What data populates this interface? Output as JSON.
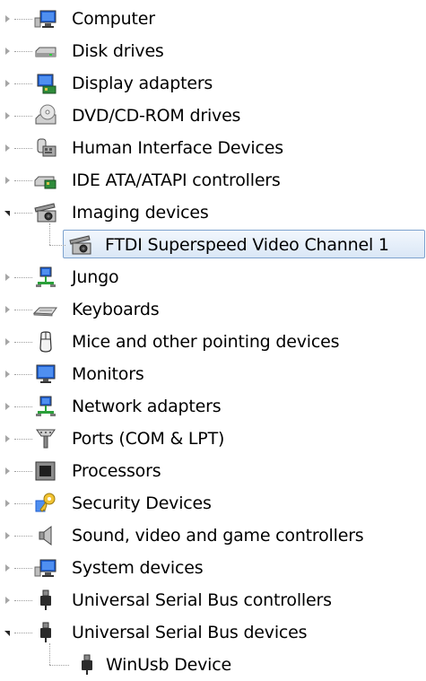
{
  "tree": {
    "items": [
      {
        "label": "Computer",
        "icon": "computer-icon",
        "state": "collapsed"
      },
      {
        "label": "Disk drives",
        "icon": "disk-drive-icon",
        "state": "collapsed"
      },
      {
        "label": "Display adapters",
        "icon": "display-adapter-icon",
        "state": "collapsed"
      },
      {
        "label": "DVD/CD-ROM drives",
        "icon": "dvd-drive-icon",
        "state": "collapsed"
      },
      {
        "label": "Human Interface Devices",
        "icon": "hid-icon",
        "state": "collapsed"
      },
      {
        "label": "IDE ATA/ATAPI controllers",
        "icon": "ide-controller-icon",
        "state": "collapsed"
      },
      {
        "label": "Imaging devices",
        "icon": "camera-icon",
        "state": "expanded"
      },
      {
        "label": "FTDI Superspeed Video Channel 1",
        "icon": "camera-icon",
        "state": "child-selected"
      },
      {
        "label": "Jungo",
        "icon": "network-icon",
        "state": "collapsed"
      },
      {
        "label": "Keyboards",
        "icon": "keyboard-icon",
        "state": "collapsed"
      },
      {
        "label": "Mice and other pointing devices",
        "icon": "mouse-icon",
        "state": "collapsed"
      },
      {
        "label": "Monitors",
        "icon": "monitor-icon",
        "state": "collapsed"
      },
      {
        "label": "Network adapters",
        "icon": "network-icon",
        "state": "collapsed"
      },
      {
        "label": "Ports (COM & LPT)",
        "icon": "port-icon",
        "state": "collapsed"
      },
      {
        "label": "Processors",
        "icon": "processor-icon",
        "state": "collapsed"
      },
      {
        "label": "Security Devices",
        "icon": "key-icon",
        "state": "collapsed"
      },
      {
        "label": "Sound, video and game controllers",
        "icon": "speaker-icon",
        "state": "collapsed"
      },
      {
        "label": "System devices",
        "icon": "computer-icon",
        "state": "collapsed"
      },
      {
        "label": "Universal Serial Bus controllers",
        "icon": "usb-plug-icon",
        "state": "collapsed"
      },
      {
        "label": "Universal Serial Bus devices",
        "icon": "usb-plug-icon",
        "state": "expanded"
      },
      {
        "label": "WinUsb Device",
        "icon": "usb-plug-icon",
        "state": "child"
      }
    ]
  },
  "colors": {
    "selection_border": "#7da2ce",
    "selection_fill": "#dae7f6",
    "monitor_blue": "#1f5fd1",
    "plug_dark": "#2b2b2b"
  }
}
